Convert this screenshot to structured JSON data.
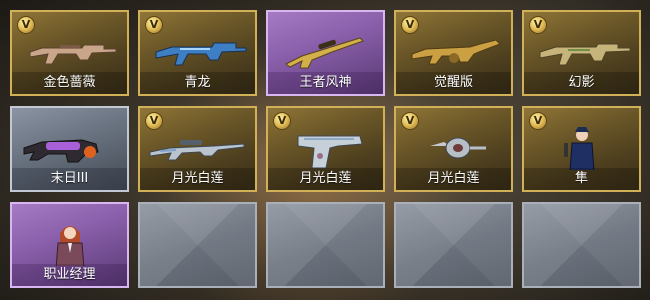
{
  "badge_text": "V",
  "items": [
    {
      "name": "金色蔷薇",
      "rarity": "gold",
      "has_badge": true,
      "icon": "rifle-icon"
    },
    {
      "name": "青龙",
      "rarity": "gold",
      "has_badge": true,
      "icon": "rifle-icon"
    },
    {
      "name": "王者风神",
      "rarity": "purple",
      "has_badge": false,
      "icon": "sniper-rifle-icon"
    },
    {
      "name": "觉醒版",
      "rarity": "gold",
      "has_badge": true,
      "icon": "machine-gun-icon"
    },
    {
      "name": "幻影",
      "rarity": "gold",
      "has_badge": true,
      "icon": "rifle-icon"
    },
    {
      "name": "末日III",
      "rarity": "grey",
      "has_badge": false,
      "icon": "grenade-launcher-icon"
    },
    {
      "name": "月光白莲",
      "rarity": "gold",
      "has_badge": true,
      "icon": "sniper-rifle-icon"
    },
    {
      "name": "月光白莲",
      "rarity": "gold",
      "has_badge": true,
      "icon": "pistol-icon"
    },
    {
      "name": "月光白莲",
      "rarity": "gold",
      "has_badge": true,
      "icon": "grenade-icon"
    },
    {
      "name": "隼",
      "rarity": "gold",
      "has_badge": true,
      "icon": "soldier-character-icon"
    },
    {
      "name": "职业经理",
      "rarity": "purple",
      "has_badge": false,
      "icon": "female-character-icon"
    }
  ],
  "empty_slots": 4,
  "colors": {
    "gold_border": "#d2b057",
    "purple_border": "#d8b6f0",
    "grey_border": "#c3c9d2"
  }
}
